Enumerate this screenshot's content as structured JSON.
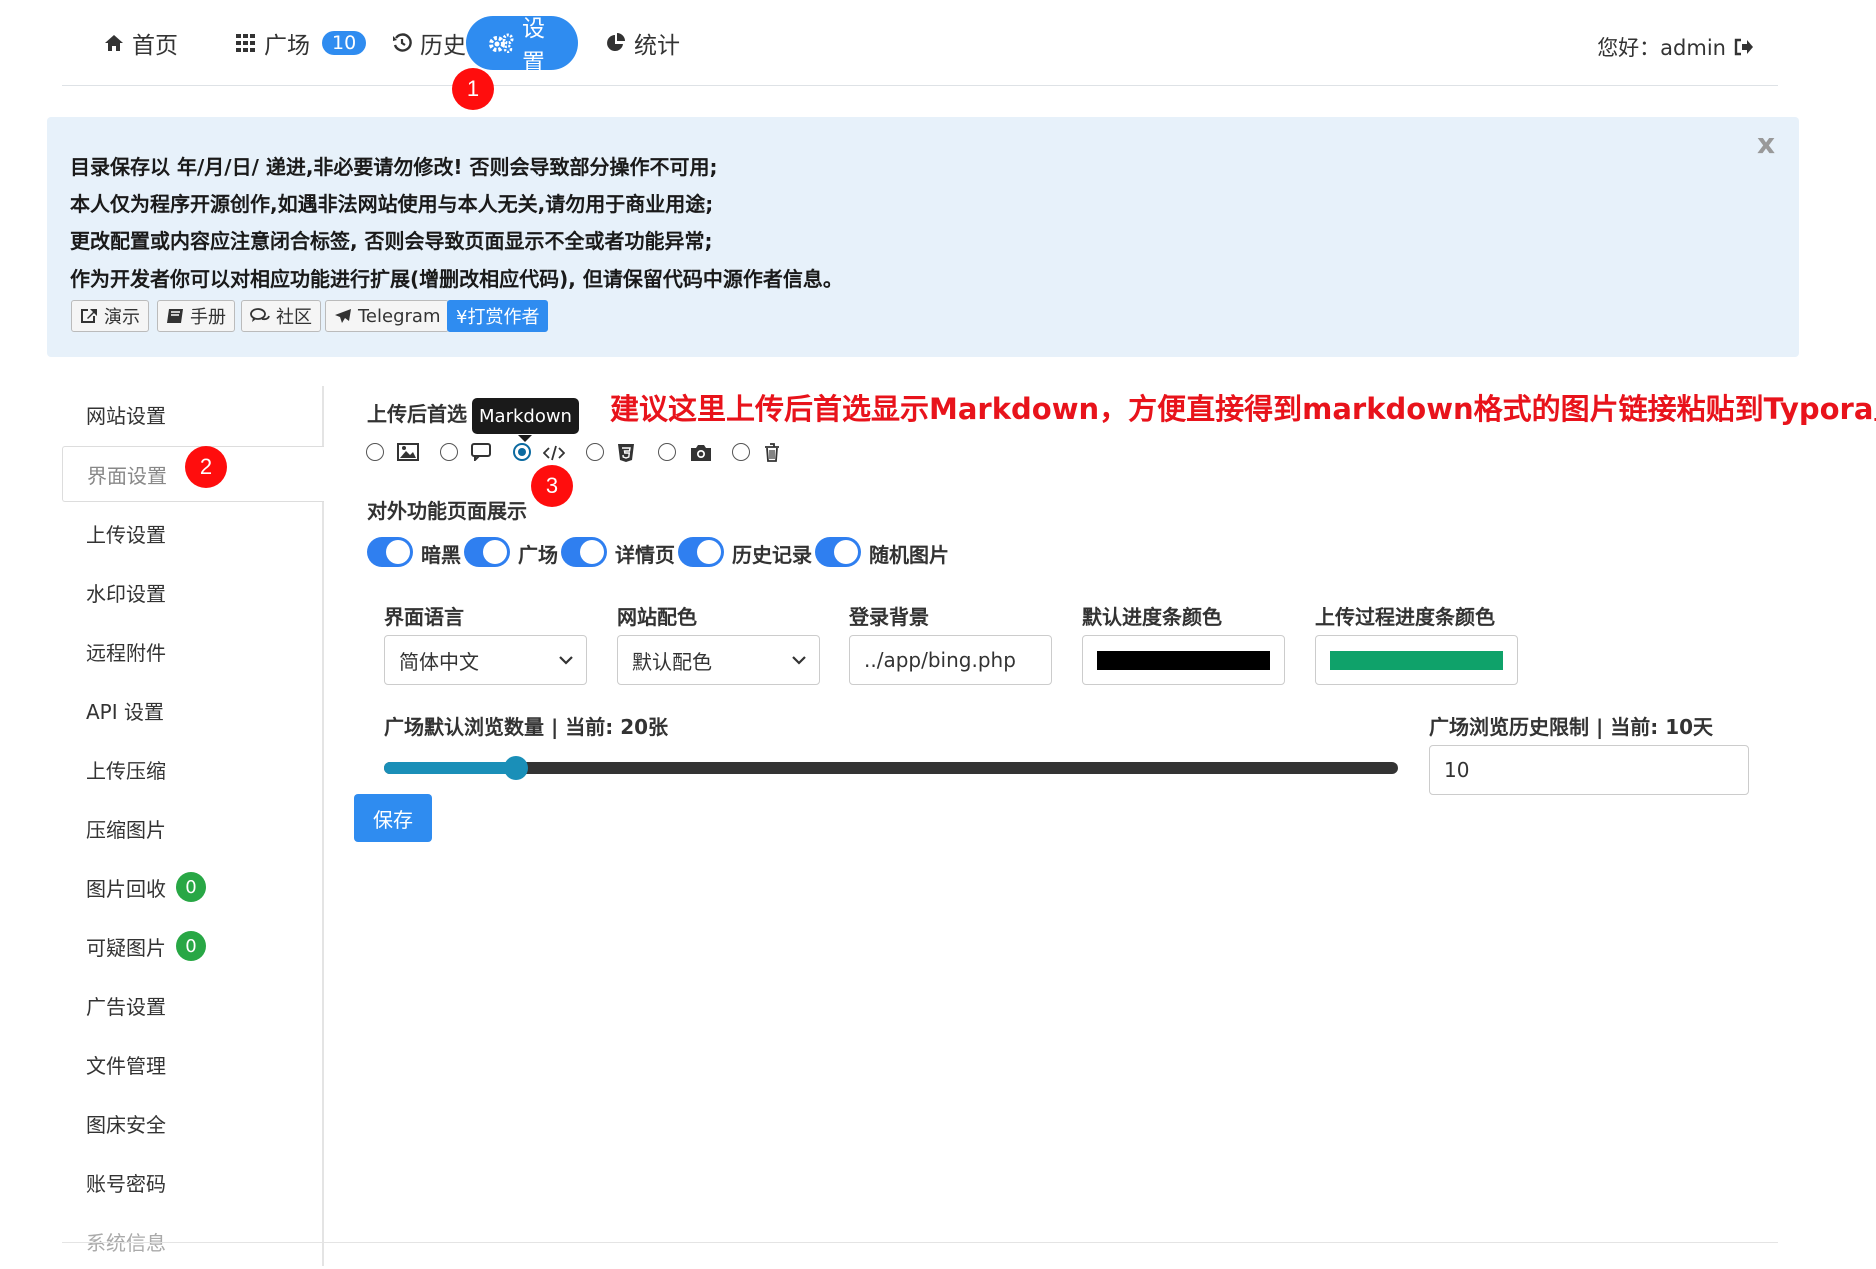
{
  "nav": {
    "items": [
      {
        "label": "首页",
        "icon": "home-icon"
      },
      {
        "label": "广场",
        "icon": "grid-icon",
        "badge": "10"
      },
      {
        "label": "历史",
        "icon": "history-icon"
      },
      {
        "label": "设置",
        "icon": "gears-icon",
        "active": true
      },
      {
        "label": "统计",
        "icon": "pie-chart-icon"
      }
    ],
    "greeting": "您好：admin",
    "logout_icon": "logout-icon"
  },
  "markers": [
    "1",
    "2",
    "3"
  ],
  "notice": {
    "lines": [
      "目录保存以 年/月/日/ 递进,非必要请勿修改! 否则会导致部分操作不可用;",
      "本人仅为程序开源创作,如遇非法网站使用与本人无关,请勿用于商业用途;",
      "更改配置或内容应注意闭合标签, 否则会导致页面显示不全或者功能异常;",
      "作为开发者你可以对相应功能进行扩展(增删改相应代码), 但请保留代码中源作者信息。"
    ],
    "close": "x",
    "buttons": [
      {
        "label": "演示",
        "icon": "external-link-icon"
      },
      {
        "label": "手册",
        "icon": "book-icon"
      },
      {
        "label": "社区",
        "icon": "comments-icon"
      },
      {
        "label": "Telegram",
        "icon": "plane-icon"
      },
      {
        "label": "¥打赏作者",
        "icon": ""
      }
    ]
  },
  "sidebar": {
    "items": [
      {
        "label": "网站设置"
      },
      {
        "label": "界面设置",
        "active": true
      },
      {
        "label": "上传设置"
      },
      {
        "label": "水印设置"
      },
      {
        "label": "远程附件"
      },
      {
        "label": "API 设置"
      },
      {
        "label": "上传压缩"
      },
      {
        "label": "压缩图片"
      },
      {
        "label": "图片回收",
        "badge": "0"
      },
      {
        "label": "可疑图片",
        "badge": "0"
      },
      {
        "label": "广告设置"
      },
      {
        "label": "文件管理"
      },
      {
        "label": "图床安全"
      },
      {
        "label": "账号密码"
      },
      {
        "label": "系统信息"
      }
    ]
  },
  "upload_pref": {
    "label": "上传后首选",
    "tooltip": "Markdown",
    "options": [
      {
        "icon": "image-icon",
        "selected": false
      },
      {
        "icon": "comment-icon",
        "selected": false
      },
      {
        "icon": "code-icon",
        "selected": true
      },
      {
        "icon": "html5-icon",
        "selected": false
      },
      {
        "icon": "camera-icon",
        "selected": false
      },
      {
        "icon": "trash-icon",
        "selected": false
      }
    ]
  },
  "annotation": "建议这里上传后首选显示Markdown，方便直接得到markdown格式的图片链接粘贴到Typora里面",
  "public_pages": {
    "label": "对外功能页面展示",
    "toggles": [
      {
        "label": "暗黑",
        "on": true
      },
      {
        "label": "广场",
        "on": true
      },
      {
        "label": "详情页",
        "on": true
      },
      {
        "label": "历史记录",
        "on": true
      },
      {
        "label": "随机图片",
        "on": true
      }
    ]
  },
  "fields": {
    "language": {
      "label": "界面语言",
      "value": "简体中文"
    },
    "theme": {
      "label": "网站配色",
      "value": "默认配色"
    },
    "login_bg": {
      "label": "登录背景",
      "value": "../app/bing.php"
    },
    "progress_color": {
      "label": "默认进度条颜色",
      "color": "#000000"
    },
    "upload_progress_color": {
      "label": "上传过程进度条颜色",
      "color": "#0fa26a"
    }
  },
  "plaza_count": {
    "label": "广场默认浏览数量 | 当前: 20张",
    "value": 20,
    "fraction": 0.13
  },
  "plaza_history": {
    "label": "广场浏览历史限制 | 当前: 10天",
    "value": "10"
  },
  "save_label": "保存",
  "colors": {
    "accent": "#2f8cf0",
    "marker": "#ff0d0d",
    "annotation": "#e8131b",
    "slider": "#1a8fb8",
    "badge": "#28a745"
  }
}
